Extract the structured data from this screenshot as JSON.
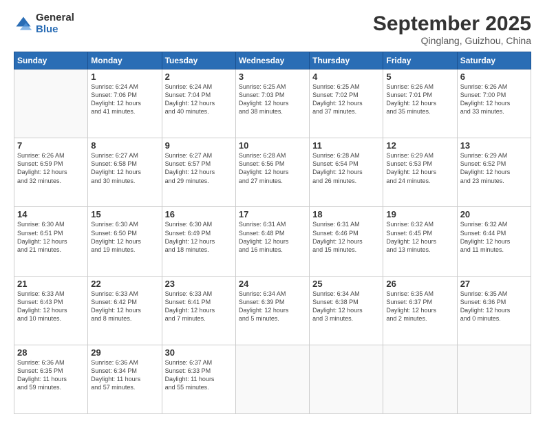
{
  "logo": {
    "general": "General",
    "blue": "Blue"
  },
  "header": {
    "month": "September 2025",
    "location": "Qinglang, Guizhou, China"
  },
  "days": [
    "Sunday",
    "Monday",
    "Tuesday",
    "Wednesday",
    "Thursday",
    "Friday",
    "Saturday"
  ],
  "weeks": [
    [
      {
        "day": "",
        "info": ""
      },
      {
        "day": "1",
        "info": "Sunrise: 6:24 AM\nSunset: 7:06 PM\nDaylight: 12 hours\nand 41 minutes."
      },
      {
        "day": "2",
        "info": "Sunrise: 6:24 AM\nSunset: 7:04 PM\nDaylight: 12 hours\nand 40 minutes."
      },
      {
        "day": "3",
        "info": "Sunrise: 6:25 AM\nSunset: 7:03 PM\nDaylight: 12 hours\nand 38 minutes."
      },
      {
        "day": "4",
        "info": "Sunrise: 6:25 AM\nSunset: 7:02 PM\nDaylight: 12 hours\nand 37 minutes."
      },
      {
        "day": "5",
        "info": "Sunrise: 6:26 AM\nSunset: 7:01 PM\nDaylight: 12 hours\nand 35 minutes."
      },
      {
        "day": "6",
        "info": "Sunrise: 6:26 AM\nSunset: 7:00 PM\nDaylight: 12 hours\nand 33 minutes."
      }
    ],
    [
      {
        "day": "7",
        "info": "Sunrise: 6:26 AM\nSunset: 6:59 PM\nDaylight: 12 hours\nand 32 minutes."
      },
      {
        "day": "8",
        "info": "Sunrise: 6:27 AM\nSunset: 6:58 PM\nDaylight: 12 hours\nand 30 minutes."
      },
      {
        "day": "9",
        "info": "Sunrise: 6:27 AM\nSunset: 6:57 PM\nDaylight: 12 hours\nand 29 minutes."
      },
      {
        "day": "10",
        "info": "Sunrise: 6:28 AM\nSunset: 6:56 PM\nDaylight: 12 hours\nand 27 minutes."
      },
      {
        "day": "11",
        "info": "Sunrise: 6:28 AM\nSunset: 6:54 PM\nDaylight: 12 hours\nand 26 minutes."
      },
      {
        "day": "12",
        "info": "Sunrise: 6:29 AM\nSunset: 6:53 PM\nDaylight: 12 hours\nand 24 minutes."
      },
      {
        "day": "13",
        "info": "Sunrise: 6:29 AM\nSunset: 6:52 PM\nDaylight: 12 hours\nand 23 minutes."
      }
    ],
    [
      {
        "day": "14",
        "info": "Sunrise: 6:30 AM\nSunset: 6:51 PM\nDaylight: 12 hours\nand 21 minutes."
      },
      {
        "day": "15",
        "info": "Sunrise: 6:30 AM\nSunset: 6:50 PM\nDaylight: 12 hours\nand 19 minutes."
      },
      {
        "day": "16",
        "info": "Sunrise: 6:30 AM\nSunset: 6:49 PM\nDaylight: 12 hours\nand 18 minutes."
      },
      {
        "day": "17",
        "info": "Sunrise: 6:31 AM\nSunset: 6:48 PM\nDaylight: 12 hours\nand 16 minutes."
      },
      {
        "day": "18",
        "info": "Sunrise: 6:31 AM\nSunset: 6:46 PM\nDaylight: 12 hours\nand 15 minutes."
      },
      {
        "day": "19",
        "info": "Sunrise: 6:32 AM\nSunset: 6:45 PM\nDaylight: 12 hours\nand 13 minutes."
      },
      {
        "day": "20",
        "info": "Sunrise: 6:32 AM\nSunset: 6:44 PM\nDaylight: 12 hours\nand 11 minutes."
      }
    ],
    [
      {
        "day": "21",
        "info": "Sunrise: 6:33 AM\nSunset: 6:43 PM\nDaylight: 12 hours\nand 10 minutes."
      },
      {
        "day": "22",
        "info": "Sunrise: 6:33 AM\nSunset: 6:42 PM\nDaylight: 12 hours\nand 8 minutes."
      },
      {
        "day": "23",
        "info": "Sunrise: 6:33 AM\nSunset: 6:41 PM\nDaylight: 12 hours\nand 7 minutes."
      },
      {
        "day": "24",
        "info": "Sunrise: 6:34 AM\nSunset: 6:39 PM\nDaylight: 12 hours\nand 5 minutes."
      },
      {
        "day": "25",
        "info": "Sunrise: 6:34 AM\nSunset: 6:38 PM\nDaylight: 12 hours\nand 3 minutes."
      },
      {
        "day": "26",
        "info": "Sunrise: 6:35 AM\nSunset: 6:37 PM\nDaylight: 12 hours\nand 2 minutes."
      },
      {
        "day": "27",
        "info": "Sunrise: 6:35 AM\nSunset: 6:36 PM\nDaylight: 12 hours\nand 0 minutes."
      }
    ],
    [
      {
        "day": "28",
        "info": "Sunrise: 6:36 AM\nSunset: 6:35 PM\nDaylight: 11 hours\nand 59 minutes."
      },
      {
        "day": "29",
        "info": "Sunrise: 6:36 AM\nSunset: 6:34 PM\nDaylight: 11 hours\nand 57 minutes."
      },
      {
        "day": "30",
        "info": "Sunrise: 6:37 AM\nSunset: 6:33 PM\nDaylight: 11 hours\nand 55 minutes."
      },
      {
        "day": "",
        "info": ""
      },
      {
        "day": "",
        "info": ""
      },
      {
        "day": "",
        "info": ""
      },
      {
        "day": "",
        "info": ""
      }
    ]
  ]
}
